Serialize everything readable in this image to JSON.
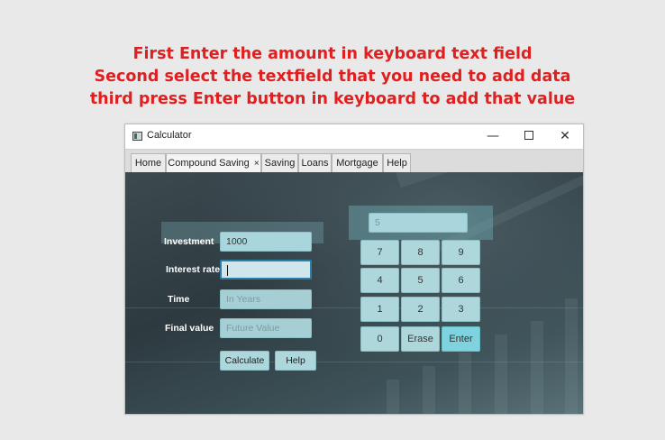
{
  "instructions": [
    "First Enter the amount in keyboard text field",
    "Second select the textfield that you need to add data",
    "third press Enter button in keyboard to add that value"
  ],
  "window": {
    "title": "Calculator",
    "minimize": "—",
    "close": "✕"
  },
  "tabs": [
    {
      "label": "Home"
    },
    {
      "label": "Compound Saving",
      "close": "×"
    },
    {
      "label": "Saving"
    },
    {
      "label": "Loans"
    },
    {
      "label": "Mortgage"
    },
    {
      "label": "Help"
    }
  ],
  "form": {
    "investment": {
      "label": "Investment",
      "value": "1000"
    },
    "interest_rate": {
      "label": "Interest rate",
      "value": ""
    },
    "time": {
      "label": "Time",
      "placeholder": "In Years"
    },
    "final_value": {
      "label": "Final value",
      "placeholder": "Future Value"
    },
    "calculate_label": "Calculate",
    "help_label": "Help"
  },
  "keypad": {
    "display": "5",
    "keys": [
      "7",
      "8",
      "9",
      "4",
      "5",
      "6",
      "1",
      "2",
      "3",
      "0",
      "Erase",
      "Enter"
    ]
  }
}
